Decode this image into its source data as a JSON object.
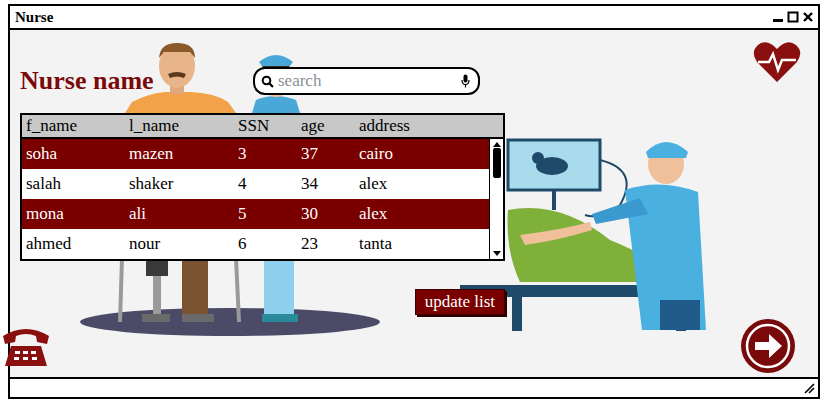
{
  "window": {
    "title": "Nurse"
  },
  "header": {
    "title": "Nurse name"
  },
  "search": {
    "placeholder": "search"
  },
  "table": {
    "columns": [
      "f_name",
      "l_name",
      "SSN",
      "age",
      "address"
    ],
    "rows": [
      {
        "cells": [
          "soha",
          "mazen",
          "3",
          "37",
          "cairo"
        ],
        "highlighted": true
      },
      {
        "cells": [
          "salah",
          "shaker",
          "4",
          "34",
          "alex"
        ],
        "highlighted": false
      },
      {
        "cells": [
          "mona",
          "ali",
          "5",
          "30",
          "alex"
        ],
        "highlighted": true
      },
      {
        "cells": [
          "ahmed",
          "nour",
          "6",
          "23",
          "tanta"
        ],
        "highlighted": false
      }
    ]
  },
  "scrollbar": {
    "level": 0
  },
  "buttons": [
    "update list"
  ]
}
